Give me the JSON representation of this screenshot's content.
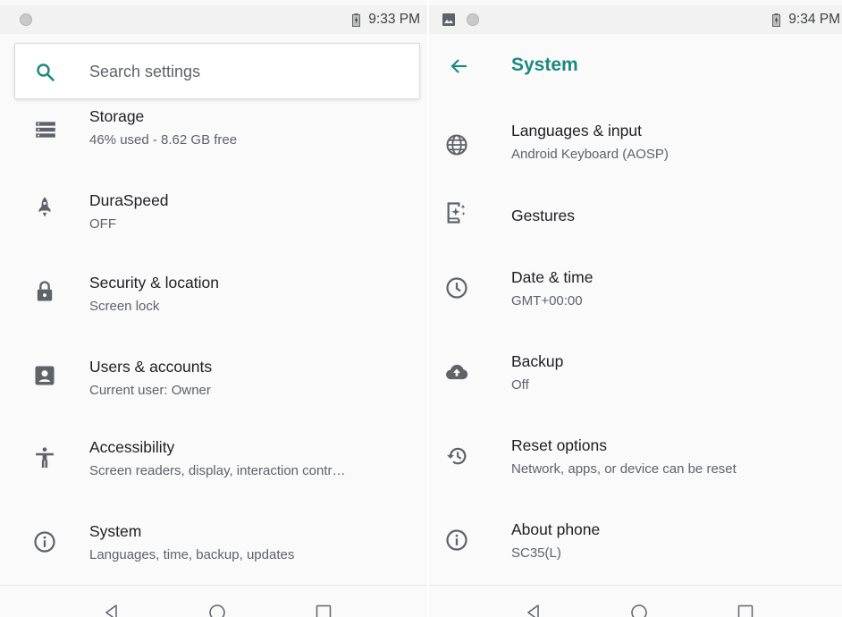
{
  "left": {
    "status": {
      "time": "9:33 PM"
    },
    "search": {
      "placeholder": "Search settings",
      "icon": "search-icon"
    },
    "items": [
      {
        "title": "Storage",
        "subtitle": "46% used - 8.62 GB free",
        "icon": "storage-icon"
      },
      {
        "title": "DuraSpeed",
        "subtitle": "OFF",
        "icon": "rocket-icon"
      },
      {
        "title": "Security & location",
        "subtitle": "Screen lock",
        "icon": "lock-icon"
      },
      {
        "title": "Users & accounts",
        "subtitle": "Current user: Owner",
        "icon": "account-box-icon"
      },
      {
        "title": "Accessibility",
        "subtitle": "Screen readers, display, interaction contr…",
        "icon": "accessibility-icon"
      },
      {
        "title": "System",
        "subtitle": "Languages, time, backup, updates",
        "icon": "info-icon"
      }
    ]
  },
  "right": {
    "status": {
      "time": "9:34 PM"
    },
    "appbar": {
      "title": "System",
      "back_icon": "arrow-back-icon"
    },
    "items": [
      {
        "title": "Languages & input",
        "subtitle": "Android Keyboard (AOSP)",
        "icon": "globe-icon"
      },
      {
        "title": "Gestures",
        "subtitle": "",
        "icon": "gestures-icon"
      },
      {
        "title": "Date & time",
        "subtitle": "GMT+00:00",
        "icon": "clock-icon"
      },
      {
        "title": "Backup",
        "subtitle": "Off",
        "icon": "cloud-upload-icon"
      },
      {
        "title": "Reset options",
        "subtitle": "Network, apps, or device can be reset",
        "icon": "restore-icon"
      },
      {
        "title": "About phone",
        "subtitle": "SC35(L)",
        "icon": "info-icon"
      }
    ]
  },
  "colors": {
    "accent": "#1a8a7e",
    "icon_gray": "#5f6368",
    "text_primary": "#202124",
    "text_secondary": "#5f6368"
  }
}
